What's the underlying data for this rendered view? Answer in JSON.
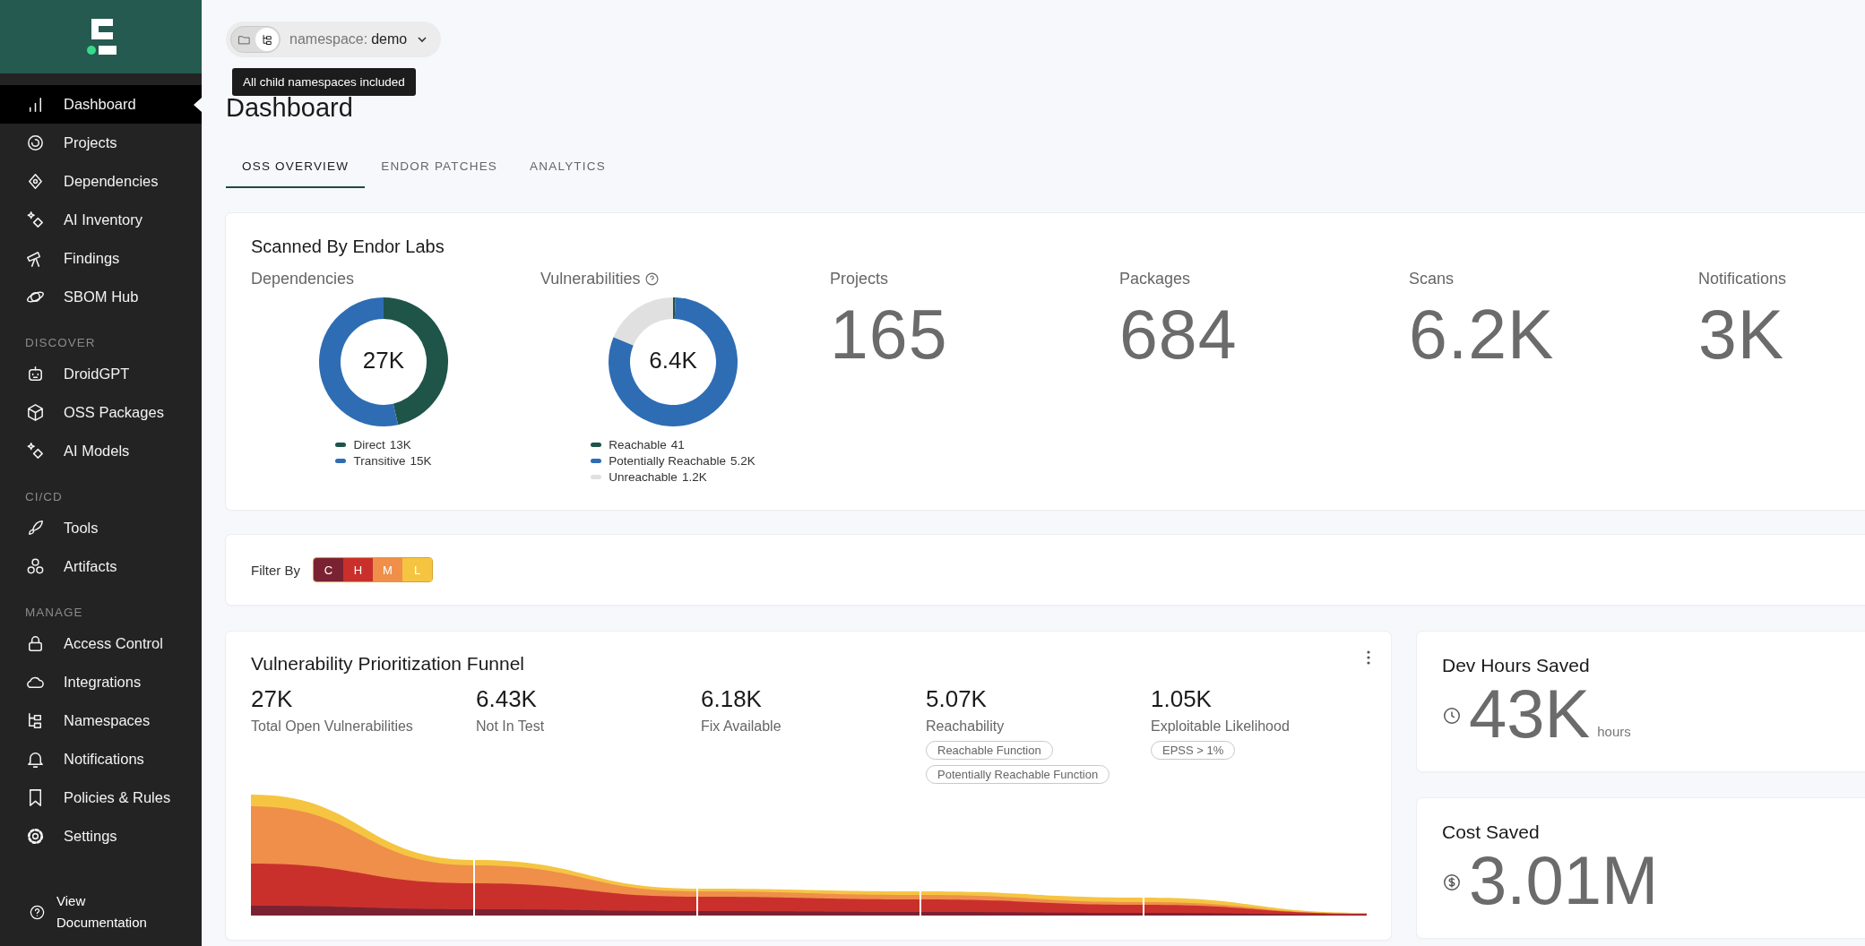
{
  "sidebar": {
    "sections": [
      {
        "items": [
          {
            "label": "Dashboard",
            "selected": true
          },
          {
            "label": "Projects",
            "selected": false
          },
          {
            "label": "Dependencies",
            "selected": false
          },
          {
            "label": "AI Inventory",
            "selected": false
          },
          {
            "label": "Findings",
            "selected": false
          },
          {
            "label": "SBOM Hub",
            "selected": false
          }
        ]
      },
      {
        "heading": "DISCOVER",
        "items": [
          {
            "label": "DroidGPT",
            "selected": false
          },
          {
            "label": "OSS Packages",
            "selected": false
          },
          {
            "label": "AI Models",
            "selected": false
          }
        ]
      },
      {
        "heading": "CI/CD",
        "items": [
          {
            "label": "Tools",
            "selected": false
          },
          {
            "label": "Artifacts",
            "selected": false
          }
        ]
      },
      {
        "heading": "MANAGE",
        "items": [
          {
            "label": "Access Control",
            "selected": false
          },
          {
            "label": "Integrations",
            "selected": false
          },
          {
            "label": "Namespaces",
            "selected": false
          },
          {
            "label": "Notifications",
            "selected": false
          },
          {
            "label": "Policies & Rules",
            "selected": false
          },
          {
            "label": "Settings",
            "selected": false
          }
        ]
      }
    ],
    "footer_link": "View Documentation"
  },
  "namespace": {
    "scope_toggle": [
      {
        "kind": "folder",
        "selected": false
      },
      {
        "kind": "tree",
        "selected": true
      }
    ],
    "label": "namespace:",
    "value": "demo",
    "tooltip": "All child namespaces included"
  },
  "page_title": "Dashboard",
  "tabs": [
    {
      "label": "OSS OVERVIEW",
      "selected": true
    },
    {
      "label": "ENDOR PATCHES",
      "selected": false
    },
    {
      "label": "ANALYTICS",
      "selected": false
    }
  ],
  "scanned": {
    "title": "Scanned By Endor Labs",
    "donuts": [
      {
        "label": "Dependencies",
        "has_help": false,
        "center": "27K",
        "slices": [
          {
            "color": "#1f5449"
          },
          {
            "color": "#2e6db4"
          }
        ],
        "chart_data": {
          "type": "donut",
          "categories": [
            "Direct",
            "Transitive"
          ],
          "values": [
            46.4,
            53.6
          ]
        },
        "legend_values": [
          "13K",
          "15K"
        ]
      },
      {
        "label": "Vulnerabilities",
        "has_help": true,
        "center": "6.4K",
        "slices": [
          {
            "color": "#1f5449"
          },
          {
            "color": "#2e6db4"
          },
          {
            "color": "#e0e0e0"
          }
        ],
        "chart_data": {
          "type": "donut",
          "categories": [
            "Reachable",
            "Potentially Reachable",
            "Unreachable"
          ],
          "values": [
            0.6,
            80.7,
            18.7
          ]
        },
        "legend_values": [
          "41",
          "5.2K",
          "1.2K"
        ]
      }
    ],
    "stats": [
      {
        "label": "Projects",
        "value": "165"
      },
      {
        "label": "Packages",
        "value": "684"
      },
      {
        "label": "Scans",
        "value": "6.2K"
      },
      {
        "label": "Notifications",
        "value": "3K"
      }
    ]
  },
  "filter": {
    "label": "Filter By",
    "severities": [
      {
        "label": "C",
        "color": "#7b2232"
      },
      {
        "label": "H",
        "color": "#c9302c"
      },
      {
        "label": "M",
        "color": "#ef8f4a"
      },
      {
        "label": "L",
        "color": "#f5c542"
      }
    ]
  },
  "funnel": {
    "title": "Vulnerability Prioritization Funnel",
    "stages": [
      {
        "value": "27K",
        "label": "Total Open Vulnerabilities"
      },
      {
        "value": "6.43K",
        "label": "Not In Test"
      },
      {
        "value": "6.18K",
        "label": "Fix Available"
      },
      {
        "value": "5.07K",
        "label": "Reachability",
        "tags": [
          "Reachable Function",
          "Potentially Reachable Function"
        ]
      },
      {
        "value": "1.05K",
        "label": "Exploitable Likelihood",
        "tags": [
          "EPSS > 1%"
        ]
      }
    ]
  },
  "savings": [
    {
      "kind": "hours",
      "title": "Dev Hours Saved",
      "value": "43K",
      "unit": "hours"
    },
    {
      "kind": "cost",
      "title": "Cost Saved",
      "value": "3.01M"
    }
  ]
}
